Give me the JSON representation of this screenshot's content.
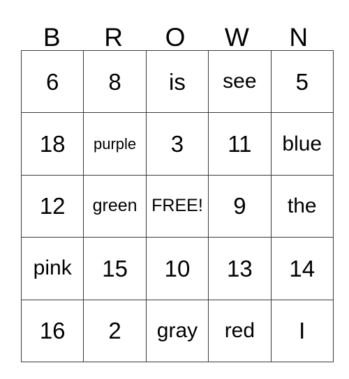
{
  "card": {
    "title_letters": [
      "B",
      "R",
      "O",
      "W",
      "N"
    ],
    "rows": [
      [
        {
          "text": "6",
          "size": "num"
        },
        {
          "text": "8",
          "size": "num"
        },
        {
          "text": "is",
          "size": "short"
        },
        {
          "text": "see",
          "size": "mid"
        },
        {
          "text": "5",
          "size": "num"
        }
      ],
      [
        {
          "text": "18",
          "size": "num"
        },
        {
          "text": "purple",
          "size": "xlong"
        },
        {
          "text": "3",
          "size": "num"
        },
        {
          "text": "11",
          "size": "num"
        },
        {
          "text": "blue",
          "size": "mid"
        }
      ],
      [
        {
          "text": "12",
          "size": "num"
        },
        {
          "text": "green",
          "size": "long"
        },
        {
          "text": "FREE!",
          "size": "long"
        },
        {
          "text": "9",
          "size": "num"
        },
        {
          "text": "the",
          "size": "mid"
        }
      ],
      [
        {
          "text": "pink",
          "size": "mid"
        },
        {
          "text": "15",
          "size": "num"
        },
        {
          "text": "10",
          "size": "num"
        },
        {
          "text": "13",
          "size": "num"
        },
        {
          "text": "14",
          "size": "num"
        }
      ],
      [
        {
          "text": "16",
          "size": "num"
        },
        {
          "text": "2",
          "size": "num"
        },
        {
          "text": "gray",
          "size": "mid"
        },
        {
          "text": "red",
          "size": "mid"
        },
        {
          "text": "I",
          "size": "num"
        }
      ]
    ],
    "free_space": "FREE!",
    "colors": {
      "background": "#ffffff",
      "grid_line": "#3a3a3a",
      "text": "#000000"
    }
  }
}
